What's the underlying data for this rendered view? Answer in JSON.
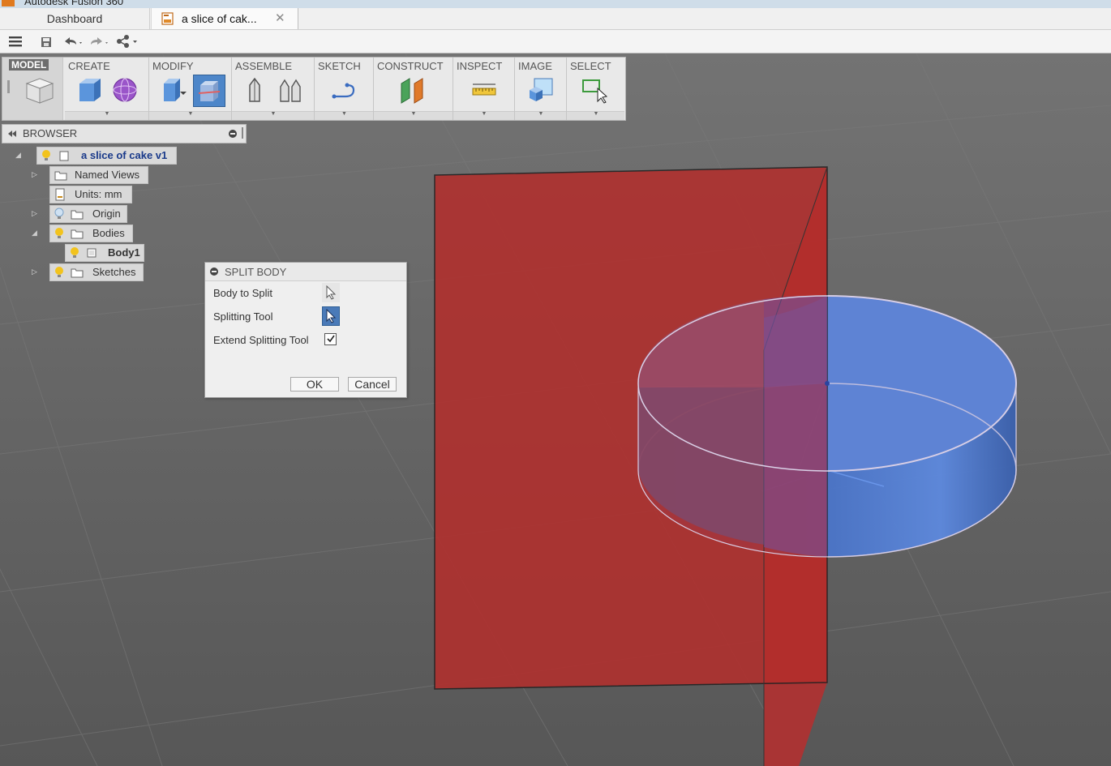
{
  "window": {
    "title": "Autodesk Fusion 360"
  },
  "tabs": {
    "dashboard": "Dashboard",
    "document": "a slice of cak...",
    "close_glyph": "✕"
  },
  "toolbar": {
    "model_label": "MODEL",
    "groups": [
      "CREATE",
      "MODIFY",
      "ASSEMBLE",
      "SKETCH",
      "CONSTRUCT",
      "INSPECT",
      "IMAGE",
      "SELECT"
    ]
  },
  "browser": {
    "title": "BROWSER",
    "root": "a slice of cake v1",
    "named_views": "Named Views",
    "units": "Units: mm",
    "origin": "Origin",
    "bodies": "Bodies",
    "body1": "Body1",
    "sketches": "Sketches"
  },
  "dialog": {
    "title": "SPLIT BODY",
    "body_to_split_label": "Body to Split",
    "splitting_tool_label": "Splitting Tool",
    "extend_label": "Extend Splitting Tool",
    "extend_checked": true,
    "ok_label": "OK",
    "cancel_label": "Cancel"
  },
  "colors": {
    "viewport_bg": "#616161",
    "plane_red": "#c8302e",
    "cylinder_blue": "#4f7fd6",
    "accent_blue": "#4a7ab8"
  }
}
